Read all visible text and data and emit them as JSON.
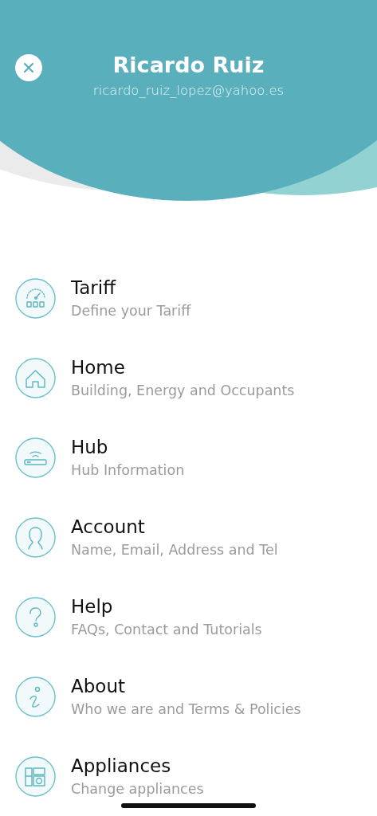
{
  "profile": {
    "name": "Ricardo Ruiz",
    "email": "ricardo_ruiz_lopez@yahoo.es"
  },
  "menu": [
    {
      "title": "Tariff",
      "subtitle": "Define your Tariff"
    },
    {
      "title": "Home",
      "subtitle": "Building, Energy and Occupants"
    },
    {
      "title": "Hub",
      "subtitle": "Hub Information"
    },
    {
      "title": "Account",
      "subtitle": "Name, Email, Address and Tel"
    },
    {
      "title": "Help",
      "subtitle": "FAQs, Contact and Tutorials"
    },
    {
      "title": "About",
      "subtitle": "Who we are and Terms & Policies"
    },
    {
      "title": "Appliances",
      "subtitle": "Change appliances"
    }
  ]
}
